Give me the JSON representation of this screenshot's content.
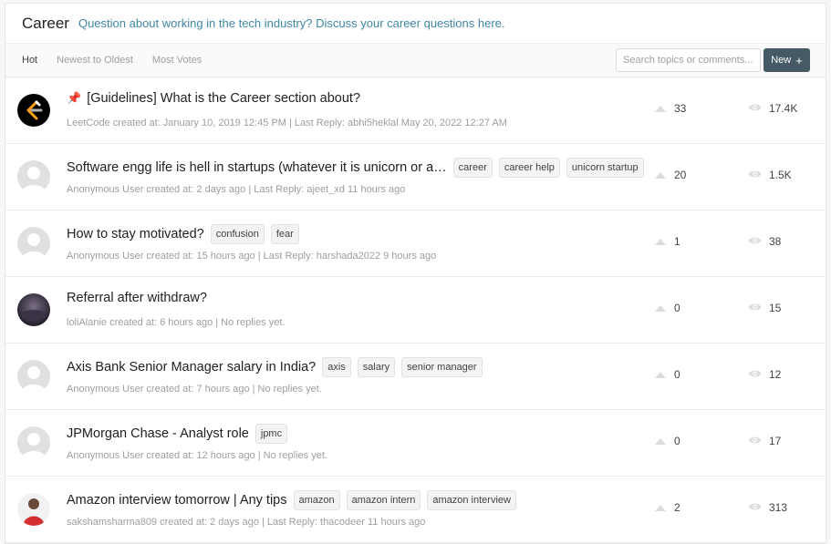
{
  "header": {
    "title": "Career",
    "description": "Question about working in the tech industry? Discuss your career questions here."
  },
  "toolbar": {
    "tabs": [
      {
        "label": "Hot",
        "active": true
      },
      {
        "label": "Newest to Oldest",
        "active": false
      },
      {
        "label": "Most Votes",
        "active": false
      }
    ],
    "search_placeholder": "Search topics or comments...",
    "new_button_label": "New",
    "new_button_icon": "+"
  },
  "topics": [
    {
      "pinned": true,
      "title": "[Guidelines] What is the Career section about?",
      "tags": [],
      "meta": "LeetCode created at: January 10, 2019 12:45 PM | Last Reply: abhi5heklal May 20, 2022 12:27 AM",
      "votes": "33",
      "views": "17.4K",
      "avatar": "leetcode-logo"
    },
    {
      "pinned": false,
      "title": "Software engg life is hell in startups (whatever it is unicorn or a…",
      "tags": [
        "career",
        "career help",
        "unicorn startup"
      ],
      "meta": "Anonymous User created at: 2 days ago | Last Reply: ajeet_xd 11 hours ago",
      "votes": "20",
      "views": "1.5K",
      "avatar": "default"
    },
    {
      "pinned": false,
      "title": "How to stay motivated?",
      "tags": [
        "confusion",
        "fear"
      ],
      "meta": "Anonymous User created at: 15 hours ago | Last Reply: harshada2022 9 hours ago",
      "votes": "1",
      "views": "38",
      "avatar": "default"
    },
    {
      "pinned": false,
      "title": "Referral after withdraw?",
      "tags": [],
      "meta": "loliAlanie created at: 6 hours ago | No replies yet.",
      "votes": "0",
      "views": "15",
      "avatar": "photo-dark"
    },
    {
      "pinned": false,
      "title": "Axis Bank Senior Manager salary in India?",
      "tags": [
        "axis",
        "salary",
        "senior manager"
      ],
      "meta": "Anonymous User created at: 7 hours ago | No replies yet.",
      "votes": "0",
      "views": "12",
      "avatar": "default"
    },
    {
      "pinned": false,
      "title": "JPMorgan Chase - Analyst role",
      "tags": [
        "jpmc"
      ],
      "meta": "Anonymous User created at: 12 hours ago | No replies yet.",
      "votes": "0",
      "views": "17",
      "avatar": "default"
    },
    {
      "pinned": false,
      "title": "Amazon interview tomorrow | Any tips",
      "tags": [
        "amazon",
        "amazon intern",
        "amazon interview"
      ],
      "meta": "sakshamsharma809 created at: 2 days ago | Last Reply: thacodeer 11 hours ago",
      "votes": "2",
      "views": "313",
      "avatar": "photo-person"
    }
  ],
  "colors": {
    "accent": "#3f87a6",
    "new_button": "#455a64",
    "leetcode_orange": "#ffa116"
  }
}
